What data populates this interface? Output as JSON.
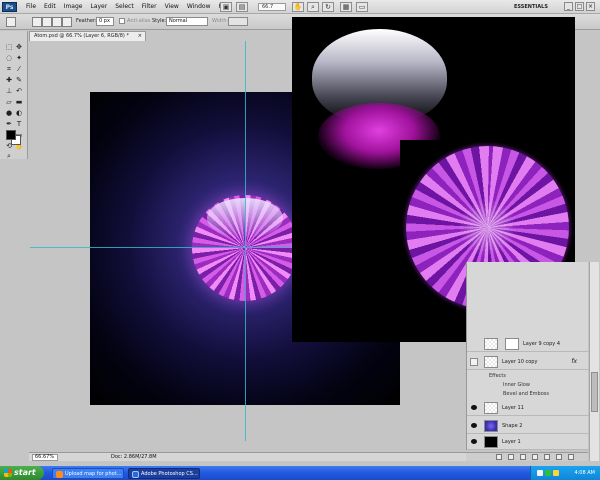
{
  "app": {
    "logo_text": "Ps",
    "menus": [
      "File",
      "Edit",
      "Image",
      "Layer",
      "Select",
      "Filter",
      "View",
      "Window",
      "Help"
    ],
    "zoom_menu_value": "66.7",
    "workspace": "ESSENTIALS",
    "window_controls": [
      "_",
      "□",
      "×"
    ]
  },
  "options_bar": {
    "feather_label": "Feather:",
    "feather_value": "0 px",
    "antialias_label": "Anti-alias",
    "style_label": "Style:",
    "style_value": "Normal",
    "width_label": "Width:"
  },
  "document": {
    "tab_title": "Atom.psd @ 66.7% (Layer 6, RGB/8) *",
    "tab_close": "×"
  },
  "layers_panel": {
    "layers": [
      {
        "name": "Layer 9 copy 4",
        "visible": false,
        "fx": false
      },
      {
        "name": "Layer 10 copy",
        "visible": false,
        "fx": true
      },
      {
        "name": "Layer 11",
        "visible": true,
        "fx": false
      },
      {
        "name": "Shape 2",
        "visible": true,
        "fx": false
      },
      {
        "name": "Layer 1",
        "visible": true,
        "fx": false
      }
    ],
    "effects_label": "Effects",
    "effects": [
      "Inner Glow",
      "Bevel and Emboss"
    ],
    "fx_label": "fx"
  },
  "status_bar": {
    "zoom": "66.67%",
    "doc_size": "Doc: 2.86M/27.8M"
  },
  "taskbar": {
    "start_label": "start",
    "tasks": [
      {
        "label": "Upload map for phot...",
        "active": false
      },
      {
        "label": "Adobe Photoshop CS...",
        "active": true
      }
    ],
    "clock": "4:08 AM"
  }
}
